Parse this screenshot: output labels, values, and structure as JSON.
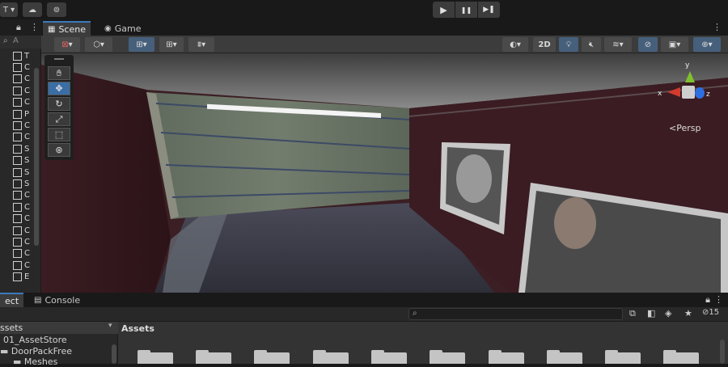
{
  "topbar": {
    "account_label": "T",
    "cloud_icon": "cloud-icon",
    "collab_icon": "collab-icon",
    "play_icon": "▶",
    "pause_icon": "❚❚",
    "step_icon": "▶❚"
  },
  "hierarchy": {
    "add_icon": "+",
    "search_placeholder": "A",
    "items": [
      "T",
      "C",
      "C",
      "C",
      "C",
      "P",
      "C",
      "C",
      "S",
      "S",
      "S",
      "S",
      "C",
      "C",
      "C",
      "C",
      "C",
      "C",
      "C",
      "E"
    ]
  },
  "scene_tabs": {
    "scene_label": "Scene",
    "game_label": "Game"
  },
  "scene_toolbar": {
    "mode_2d": "2D"
  },
  "gizmo": {
    "x_label": "x",
    "y_label": "y",
    "z_label": "z",
    "persp_label": "<Persp"
  },
  "bottom": {
    "project_tab": "ect",
    "console_tab": "Console",
    "hidden_count": "15",
    "tree_header": "ssets",
    "tree_items": [
      "01_AssetStore",
      "DoorPackFree",
      "Meshes"
    ],
    "assets_header": "Assets"
  },
  "colors": {
    "accent": "#3a79bb",
    "wall": "#3b1f24",
    "floor": "#3a3a48",
    "door": "#6f7a6c"
  }
}
